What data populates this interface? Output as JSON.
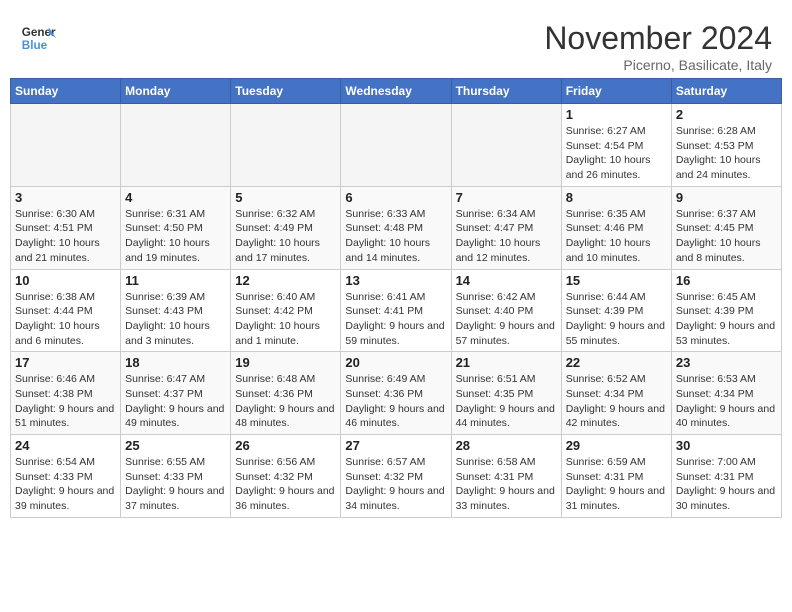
{
  "header": {
    "logo_line1": "General",
    "logo_line2": "Blue",
    "month": "November 2024",
    "location": "Picerno, Basilicate, Italy"
  },
  "weekdays": [
    "Sunday",
    "Monday",
    "Tuesday",
    "Wednesday",
    "Thursday",
    "Friday",
    "Saturday"
  ],
  "weeks": [
    [
      {
        "day": "",
        "info": ""
      },
      {
        "day": "",
        "info": ""
      },
      {
        "day": "",
        "info": ""
      },
      {
        "day": "",
        "info": ""
      },
      {
        "day": "",
        "info": ""
      },
      {
        "day": "1",
        "info": "Sunrise: 6:27 AM\nSunset: 4:54 PM\nDaylight: 10 hours and 26 minutes."
      },
      {
        "day": "2",
        "info": "Sunrise: 6:28 AM\nSunset: 4:53 PM\nDaylight: 10 hours and 24 minutes."
      }
    ],
    [
      {
        "day": "3",
        "info": "Sunrise: 6:30 AM\nSunset: 4:51 PM\nDaylight: 10 hours and 21 minutes."
      },
      {
        "day": "4",
        "info": "Sunrise: 6:31 AM\nSunset: 4:50 PM\nDaylight: 10 hours and 19 minutes."
      },
      {
        "day": "5",
        "info": "Sunrise: 6:32 AM\nSunset: 4:49 PM\nDaylight: 10 hours and 17 minutes."
      },
      {
        "day": "6",
        "info": "Sunrise: 6:33 AM\nSunset: 4:48 PM\nDaylight: 10 hours and 14 minutes."
      },
      {
        "day": "7",
        "info": "Sunrise: 6:34 AM\nSunset: 4:47 PM\nDaylight: 10 hours and 12 minutes."
      },
      {
        "day": "8",
        "info": "Sunrise: 6:35 AM\nSunset: 4:46 PM\nDaylight: 10 hours and 10 minutes."
      },
      {
        "day": "9",
        "info": "Sunrise: 6:37 AM\nSunset: 4:45 PM\nDaylight: 10 hours and 8 minutes."
      }
    ],
    [
      {
        "day": "10",
        "info": "Sunrise: 6:38 AM\nSunset: 4:44 PM\nDaylight: 10 hours and 6 minutes."
      },
      {
        "day": "11",
        "info": "Sunrise: 6:39 AM\nSunset: 4:43 PM\nDaylight: 10 hours and 3 minutes."
      },
      {
        "day": "12",
        "info": "Sunrise: 6:40 AM\nSunset: 4:42 PM\nDaylight: 10 hours and 1 minute."
      },
      {
        "day": "13",
        "info": "Sunrise: 6:41 AM\nSunset: 4:41 PM\nDaylight: 9 hours and 59 minutes."
      },
      {
        "day": "14",
        "info": "Sunrise: 6:42 AM\nSunset: 4:40 PM\nDaylight: 9 hours and 57 minutes."
      },
      {
        "day": "15",
        "info": "Sunrise: 6:44 AM\nSunset: 4:39 PM\nDaylight: 9 hours and 55 minutes."
      },
      {
        "day": "16",
        "info": "Sunrise: 6:45 AM\nSunset: 4:39 PM\nDaylight: 9 hours and 53 minutes."
      }
    ],
    [
      {
        "day": "17",
        "info": "Sunrise: 6:46 AM\nSunset: 4:38 PM\nDaylight: 9 hours and 51 minutes."
      },
      {
        "day": "18",
        "info": "Sunrise: 6:47 AM\nSunset: 4:37 PM\nDaylight: 9 hours and 49 minutes."
      },
      {
        "day": "19",
        "info": "Sunrise: 6:48 AM\nSunset: 4:36 PM\nDaylight: 9 hours and 48 minutes."
      },
      {
        "day": "20",
        "info": "Sunrise: 6:49 AM\nSunset: 4:36 PM\nDaylight: 9 hours and 46 minutes."
      },
      {
        "day": "21",
        "info": "Sunrise: 6:51 AM\nSunset: 4:35 PM\nDaylight: 9 hours and 44 minutes."
      },
      {
        "day": "22",
        "info": "Sunrise: 6:52 AM\nSunset: 4:34 PM\nDaylight: 9 hours and 42 minutes."
      },
      {
        "day": "23",
        "info": "Sunrise: 6:53 AM\nSunset: 4:34 PM\nDaylight: 9 hours and 40 minutes."
      }
    ],
    [
      {
        "day": "24",
        "info": "Sunrise: 6:54 AM\nSunset: 4:33 PM\nDaylight: 9 hours and 39 minutes."
      },
      {
        "day": "25",
        "info": "Sunrise: 6:55 AM\nSunset: 4:33 PM\nDaylight: 9 hours and 37 minutes."
      },
      {
        "day": "26",
        "info": "Sunrise: 6:56 AM\nSunset: 4:32 PM\nDaylight: 9 hours and 36 minutes."
      },
      {
        "day": "27",
        "info": "Sunrise: 6:57 AM\nSunset: 4:32 PM\nDaylight: 9 hours and 34 minutes."
      },
      {
        "day": "28",
        "info": "Sunrise: 6:58 AM\nSunset: 4:31 PM\nDaylight: 9 hours and 33 minutes."
      },
      {
        "day": "29",
        "info": "Sunrise: 6:59 AM\nSunset: 4:31 PM\nDaylight: 9 hours and 31 minutes."
      },
      {
        "day": "30",
        "info": "Sunrise: 7:00 AM\nSunset: 4:31 PM\nDaylight: 9 hours and 30 minutes."
      }
    ]
  ]
}
